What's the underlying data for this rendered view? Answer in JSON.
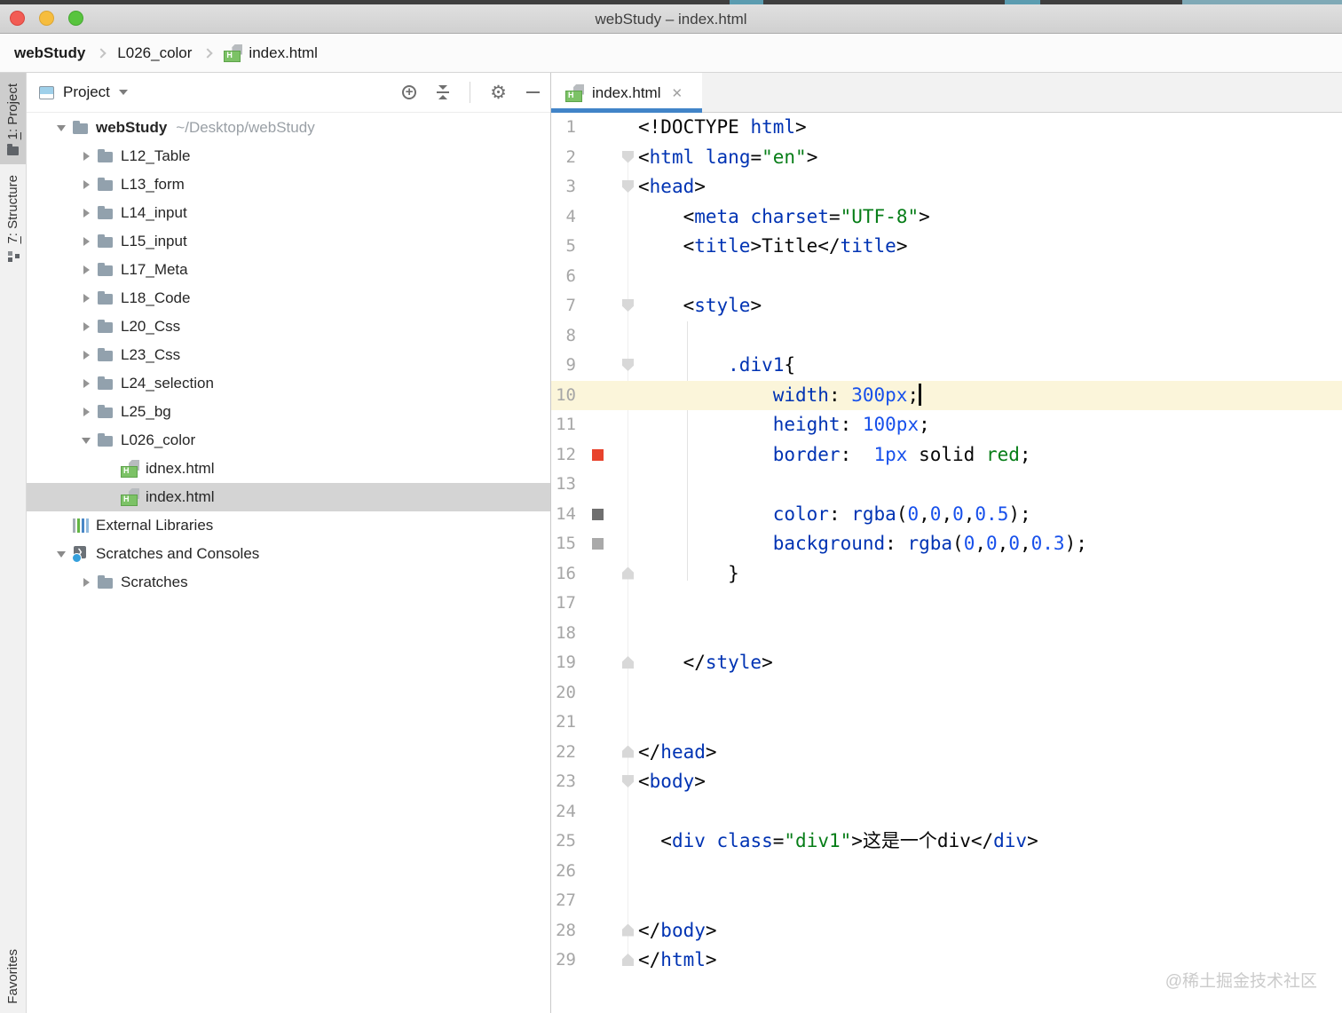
{
  "window": {
    "title": "webStudy – index.html"
  },
  "breadcrumbs": {
    "items": [
      "webStudy",
      "L026_color",
      "index.html"
    ]
  },
  "left_strip": {
    "items": [
      {
        "mnemonic": "1",
        "rest": ": Project",
        "icon": "folder-mini-icon",
        "active": true
      },
      {
        "mnemonic": "7",
        "rest": ": Structure",
        "icon": "structure-icon",
        "active": false
      }
    ],
    "bottom_label": "Favorites"
  },
  "project_panel": {
    "header": {
      "title": "Project",
      "tool_icons": [
        "locate-icon",
        "collapse-all-icon",
        "settings-gear-icon",
        "hide-panel-icon"
      ]
    },
    "tree": [
      {
        "label": "webStudy",
        "suffix": "~/Desktop/webStudy",
        "icon": "folder",
        "arrow": "down",
        "level": 0,
        "bold": true,
        "selected": false
      },
      {
        "label": "L12_Table",
        "icon": "folder",
        "arrow": "right",
        "level": 1,
        "selected": false
      },
      {
        "label": "L13_form",
        "icon": "folder",
        "arrow": "right",
        "level": 1,
        "selected": false
      },
      {
        "label": "L14_input",
        "icon": "folder",
        "arrow": "right",
        "level": 1,
        "selected": false
      },
      {
        "label": "L15_input",
        "icon": "folder",
        "arrow": "right",
        "level": 1,
        "selected": false
      },
      {
        "label": "L17_Meta",
        "icon": "folder",
        "arrow": "right",
        "level": 1,
        "selected": false
      },
      {
        "label": "L18_Code",
        "icon": "folder",
        "arrow": "right",
        "level": 1,
        "selected": false
      },
      {
        "label": "L20_Css",
        "icon": "folder",
        "arrow": "right",
        "level": 1,
        "selected": false
      },
      {
        "label": "L23_Css",
        "icon": "folder",
        "arrow": "right",
        "level": 1,
        "selected": false
      },
      {
        "label": "L24_selection",
        "icon": "folder",
        "arrow": "right",
        "level": 1,
        "selected": false
      },
      {
        "label": "L25_bg",
        "icon": "folder",
        "arrow": "right",
        "level": 1,
        "selected": false
      },
      {
        "label": "L026_color",
        "icon": "folder",
        "arrow": "down",
        "level": 1,
        "selected": false
      },
      {
        "label": "idnex.html",
        "icon": "html",
        "arrow": "none",
        "level": 2,
        "selected": false
      },
      {
        "label": "index.html",
        "icon": "html",
        "arrow": "none",
        "level": 2,
        "selected": true
      },
      {
        "label": "External Libraries",
        "icon": "libs",
        "arrow": "none",
        "level": 0,
        "selected": false
      },
      {
        "label": "Scratches and Consoles",
        "icon": "scratch",
        "arrow": "down",
        "level": 0,
        "selected": false
      },
      {
        "label": "Scratches",
        "icon": "folder",
        "arrow": "right",
        "level": 1,
        "selected": false
      }
    ]
  },
  "editor": {
    "tab": {
      "label": "index.html",
      "close_glyph": "✕"
    },
    "colors": {
      "accent_blue": "#4184c8",
      "current_line": "#fbf5da",
      "selection_gray": "#d4d4d4",
      "tag_blue": "#0033b3",
      "number_blue": "#1750eb",
      "string_green": "#067d17"
    },
    "lines": [
      {
        "n": 1,
        "toks": [
          [
            "p",
            "<!DOCTYPE "
          ],
          [
            "t",
            "html"
          ],
          [
            "p",
            ">"
          ]
        ]
      },
      {
        "n": 2,
        "fold": "down",
        "toks": [
          [
            "p",
            "<"
          ],
          [
            "t",
            "html"
          ],
          [
            "p",
            " "
          ],
          [
            "t",
            "lang"
          ],
          [
            "p",
            "="
          ],
          [
            "s",
            "\"en\""
          ],
          [
            "p",
            ">"
          ]
        ]
      },
      {
        "n": 3,
        "fold": "down",
        "toks": [
          [
            "p",
            "<"
          ],
          [
            "t",
            "head"
          ],
          [
            "p",
            ">"
          ]
        ]
      },
      {
        "n": 4,
        "toks": [
          [
            "p",
            "    <"
          ],
          [
            "t",
            "meta"
          ],
          [
            "p",
            " "
          ],
          [
            "t",
            "charset"
          ],
          [
            "p",
            "="
          ],
          [
            "s",
            "\"UTF-8\""
          ],
          [
            "p",
            ">"
          ]
        ]
      },
      {
        "n": 5,
        "toks": [
          [
            "p",
            "    <"
          ],
          [
            "t",
            "title"
          ],
          [
            "p",
            ">Title</"
          ],
          [
            "t",
            "title"
          ],
          [
            "p",
            ">"
          ]
        ]
      },
      {
        "n": 6,
        "toks": []
      },
      {
        "n": 7,
        "fold": "down",
        "toks": [
          [
            "p",
            "    <"
          ],
          [
            "t",
            "style"
          ],
          [
            "p",
            ">"
          ]
        ]
      },
      {
        "n": 8,
        "toks": []
      },
      {
        "n": 9,
        "fold": "down",
        "toks": [
          [
            "p",
            "        "
          ],
          [
            "t",
            ".div1"
          ],
          [
            "p",
            "{"
          ]
        ]
      },
      {
        "n": 10,
        "current": true,
        "caret": true,
        "toks": [
          [
            "p",
            "            "
          ],
          [
            "t",
            "width"
          ],
          [
            "p",
            ": "
          ],
          [
            "n",
            "300px"
          ],
          [
            "p",
            ";"
          ]
        ]
      },
      {
        "n": 11,
        "toks": [
          [
            "p",
            "            "
          ],
          [
            "t",
            "height"
          ],
          [
            "p",
            ": "
          ],
          [
            "n",
            "100px"
          ],
          [
            "p",
            ";"
          ]
        ]
      },
      {
        "n": 12,
        "mark": "#e8432d",
        "toks": [
          [
            "p",
            "            "
          ],
          [
            "t",
            "border"
          ],
          [
            "p",
            ":  "
          ],
          [
            "n",
            "1px"
          ],
          [
            "p",
            " solid "
          ],
          [
            "s",
            "red"
          ],
          [
            "p",
            ";"
          ]
        ]
      },
      {
        "n": 13,
        "toks": []
      },
      {
        "n": 14,
        "mark": "#6f6f6f",
        "toks": [
          [
            "p",
            "            "
          ],
          [
            "t",
            "color"
          ],
          [
            "p",
            ": "
          ],
          [
            "t",
            "rgba"
          ],
          [
            "p",
            "("
          ],
          [
            "n",
            "0"
          ],
          [
            "p",
            ","
          ],
          [
            "n",
            "0"
          ],
          [
            "p",
            ","
          ],
          [
            "n",
            "0"
          ],
          [
            "p",
            ","
          ],
          [
            "n",
            "0.5"
          ],
          [
            "p",
            ");"
          ]
        ]
      },
      {
        "n": 15,
        "mark": "#a9a9a9",
        "toks": [
          [
            "p",
            "            "
          ],
          [
            "t",
            "background"
          ],
          [
            "p",
            ": "
          ],
          [
            "t",
            "rgba"
          ],
          [
            "p",
            "("
          ],
          [
            "n",
            "0"
          ],
          [
            "p",
            ","
          ],
          [
            "n",
            "0"
          ],
          [
            "p",
            ","
          ],
          [
            "n",
            "0"
          ],
          [
            "p",
            ","
          ],
          [
            "n",
            "0.3"
          ],
          [
            "p",
            ");"
          ]
        ]
      },
      {
        "n": 16,
        "fold": "up",
        "toks": [
          [
            "p",
            "        }"
          ]
        ]
      },
      {
        "n": 17,
        "toks": []
      },
      {
        "n": 18,
        "toks": []
      },
      {
        "n": 19,
        "fold": "up",
        "toks": [
          [
            "p",
            "    </"
          ],
          [
            "t",
            "style"
          ],
          [
            "p",
            ">"
          ]
        ]
      },
      {
        "n": 20,
        "toks": []
      },
      {
        "n": 21,
        "toks": []
      },
      {
        "n": 22,
        "fold": "up",
        "toks": [
          [
            "p",
            "</"
          ],
          [
            "t",
            "head"
          ],
          [
            "p",
            ">"
          ]
        ]
      },
      {
        "n": 23,
        "fold": "down",
        "toks": [
          [
            "p",
            "<"
          ],
          [
            "t",
            "body"
          ],
          [
            "p",
            ">"
          ]
        ]
      },
      {
        "n": 24,
        "toks": []
      },
      {
        "n": 25,
        "toks": [
          [
            "p",
            "  <"
          ],
          [
            "t",
            "div"
          ],
          [
            "p",
            " "
          ],
          [
            "t",
            "class"
          ],
          [
            "p",
            "="
          ],
          [
            "s",
            "\"div1\""
          ],
          [
            "p",
            ">这是一个div</"
          ],
          [
            "t",
            "div"
          ],
          [
            "p",
            ">"
          ]
        ]
      },
      {
        "n": 26,
        "toks": []
      },
      {
        "n": 27,
        "toks": []
      },
      {
        "n": 28,
        "fold": "up",
        "toks": [
          [
            "p",
            "</"
          ],
          [
            "t",
            "body"
          ],
          [
            "p",
            ">"
          ]
        ]
      },
      {
        "n": 29,
        "fold": "up",
        "toks": [
          [
            "p",
            "</"
          ],
          [
            "t",
            "html"
          ],
          [
            "p",
            ">"
          ]
        ]
      }
    ]
  },
  "watermark": "@稀土掘金技术社区"
}
